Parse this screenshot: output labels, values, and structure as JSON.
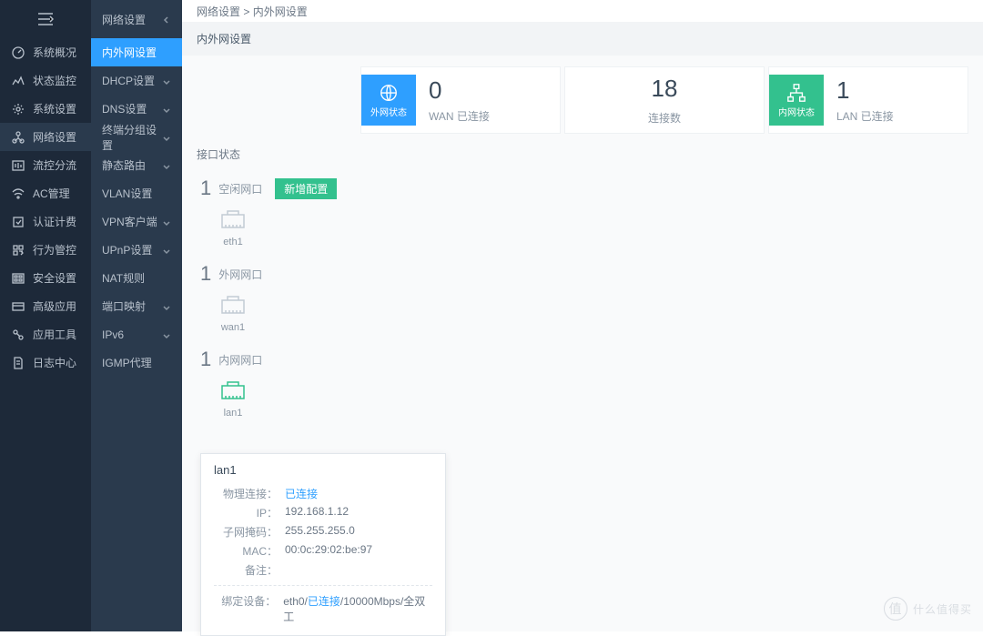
{
  "sidebar1": {
    "items": [
      {
        "label": "系统概况",
        "icon": "dashboard"
      },
      {
        "label": "状态监控",
        "icon": "monitor"
      },
      {
        "label": "系统设置",
        "icon": "gear"
      },
      {
        "label": "网络设置",
        "icon": "network",
        "active": true
      },
      {
        "label": "流控分流",
        "icon": "flow"
      },
      {
        "label": "AC管理",
        "icon": "wifi"
      },
      {
        "label": "认证计费",
        "icon": "auth"
      },
      {
        "label": "行为管控",
        "icon": "behavior"
      },
      {
        "label": "安全设置",
        "icon": "security"
      },
      {
        "label": "高级应用",
        "icon": "app"
      },
      {
        "label": "应用工具",
        "icon": "tools"
      },
      {
        "label": "日志中心",
        "icon": "log"
      }
    ]
  },
  "sidebar2": {
    "header": "网络设置",
    "items": [
      {
        "label": "内外网设置",
        "active": true
      },
      {
        "label": "DHCP设置",
        "expandable": true
      },
      {
        "label": "DNS设置",
        "expandable": true
      },
      {
        "label": "终端分组设置",
        "expandable": true
      },
      {
        "label": "静态路由",
        "expandable": true
      },
      {
        "label": "VLAN设置"
      },
      {
        "label": "VPN客户端",
        "expandable": true
      },
      {
        "label": "UPnP设置",
        "expandable": true
      },
      {
        "label": "NAT规则"
      },
      {
        "label": "端口映射",
        "expandable": true
      },
      {
        "label": "IPv6",
        "expandable": true
      },
      {
        "label": "IGMP代理"
      }
    ]
  },
  "breadcrumb": {
    "a": "网络设置",
    "sep": ">",
    "b": "内外网设置"
  },
  "page_title": "内外网设置",
  "stats": {
    "wan": {
      "num": "0",
      "label": "WAN 已连接",
      "icon_label": "外网状态"
    },
    "conn": {
      "num": "18",
      "label": "连接数"
    },
    "lan": {
      "num": "1",
      "label": "LAN 已连接",
      "icon_label": "内网状态"
    }
  },
  "section_header": "接口状态",
  "groups": [
    {
      "count": "1",
      "title": "空闲网口",
      "new_btn": "新增配置",
      "ports": [
        {
          "name": "eth1",
          "state": "gray"
        }
      ]
    },
    {
      "count": "1",
      "title": "外网网口",
      "ports": [
        {
          "name": "wan1",
          "state": "gray"
        }
      ]
    },
    {
      "count": "1",
      "title": "内网网口",
      "ports": [
        {
          "name": "lan1",
          "state": "green"
        }
      ]
    }
  ],
  "tooltip": {
    "title": "lan1",
    "rows": [
      {
        "label": "物理连接：",
        "val": "已连接",
        "link": true
      },
      {
        "label": "IP：",
        "val": "192.168.1.12"
      },
      {
        "label": "子网掩码：",
        "val": "255.255.255.0"
      },
      {
        "label": "MAC：",
        "val": "00:0c:29:02:be:97"
      },
      {
        "label": "备注：",
        "val": ""
      }
    ],
    "bind": {
      "label": "绑定设备：",
      "prefix": "eth0/",
      "link": "已连接",
      "suffix": "/10000Mbps/全双工"
    }
  },
  "watermark": "什么值得买"
}
